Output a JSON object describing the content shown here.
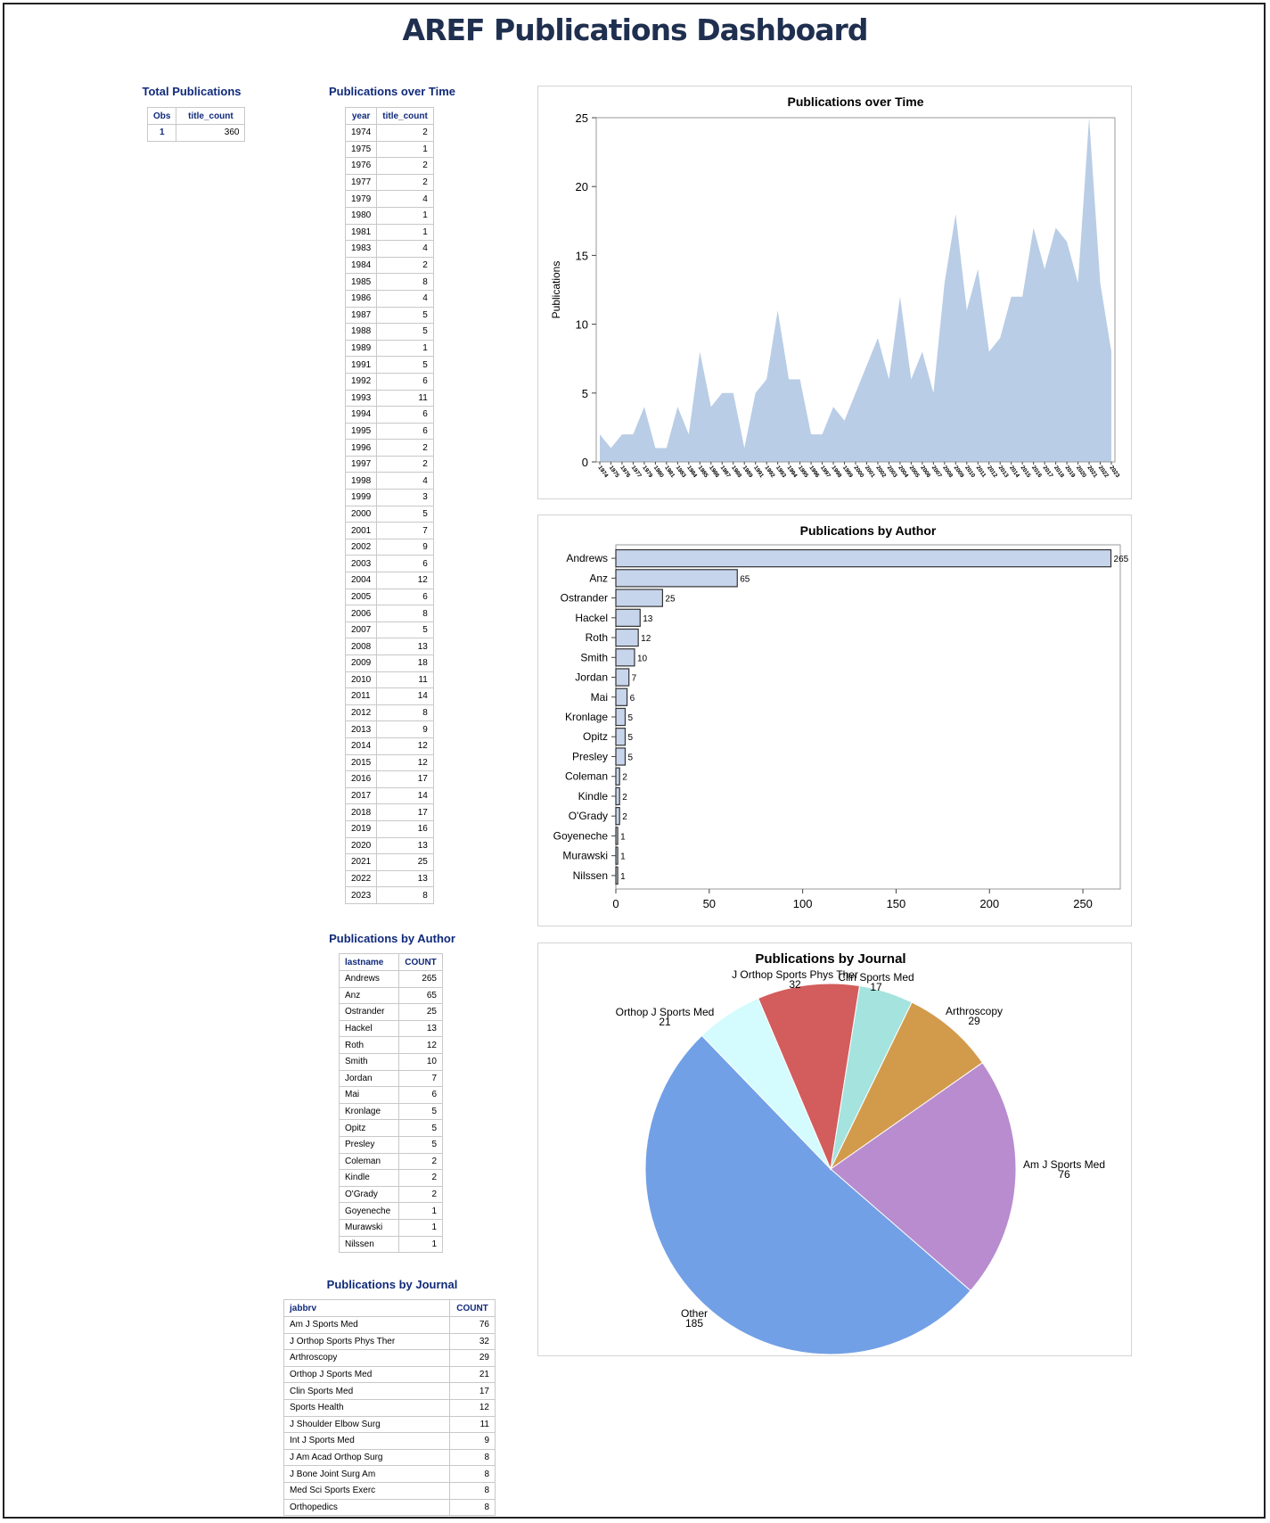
{
  "page": {
    "title": "AREF Publications Dashboard"
  },
  "total": {
    "title": "Total Publications",
    "headers": [
      "Obs",
      "title_count"
    ],
    "rows": [
      [
        "1",
        "360"
      ]
    ]
  },
  "time_table": {
    "title": "Publications over Time",
    "headers": [
      "year",
      "title_count"
    ]
  },
  "author_table": {
    "title": "Publications by Author",
    "headers": [
      "lastname",
      "COUNT"
    ]
  },
  "journal_table": {
    "title": "Publications by Journal",
    "headers": [
      "jabbrv",
      "COUNT"
    ],
    "rows": [
      [
        "Am J Sports Med",
        "76"
      ],
      [
        "J Orthop Sports Phys Ther",
        "32"
      ],
      [
        "Arthroscopy",
        "29"
      ],
      [
        "Orthop J Sports Med",
        "21"
      ],
      [
        "Clin Sports Med",
        "17"
      ],
      [
        "Sports Health",
        "12"
      ],
      [
        "J Shoulder Elbow Surg",
        "11"
      ],
      [
        "Int J Sports Med",
        "9"
      ],
      [
        "J Am Acad Orthop Surg",
        "8"
      ],
      [
        "J Bone Joint Surg Am",
        "8"
      ],
      [
        "Med Sci Sports Exerc",
        "8"
      ],
      [
        "Orthopedics",
        "8"
      ]
    ]
  },
  "chart_data": [
    {
      "type": "area",
      "title": "Publications over Time",
      "xlabel": "",
      "ylabel": "Publications",
      "ylim": [
        0,
        25
      ],
      "yticks": [
        0,
        5,
        10,
        15,
        20,
        25
      ],
      "color": "#b9cde6",
      "x": [
        "1974",
        "1975",
        "1976",
        "1977",
        "1979",
        "1980",
        "1981",
        "1983",
        "1984",
        "1985",
        "1986",
        "1987",
        "1988",
        "1989",
        "1991",
        "1992",
        "1993",
        "1994",
        "1995",
        "1996",
        "1997",
        "1998",
        "1999",
        "2000",
        "2001",
        "2002",
        "2003",
        "2004",
        "2005",
        "2006",
        "2007",
        "2008",
        "2009",
        "2010",
        "2011",
        "2012",
        "2013",
        "2014",
        "2015",
        "2016",
        "2017",
        "2018",
        "2019",
        "2020",
        "2021",
        "2022",
        "2023"
      ],
      "values": [
        2,
        1,
        2,
        2,
        4,
        1,
        1,
        4,
        2,
        8,
        4,
        5,
        5,
        1,
        5,
        6,
        11,
        6,
        6,
        2,
        2,
        4,
        3,
        5,
        7,
        9,
        6,
        12,
        6,
        8,
        5,
        13,
        18,
        11,
        14,
        8,
        9,
        12,
        12,
        17,
        14,
        17,
        16,
        13,
        25,
        13,
        8
      ]
    },
    {
      "type": "bar",
      "orientation": "horizontal",
      "title": "Publications by Author",
      "xlim": [
        0,
        270
      ],
      "xticks": [
        0,
        50,
        100,
        150,
        200,
        250
      ],
      "color": "#c7d5ec",
      "categories": [
        "Andrews",
        "Anz",
        "Ostrander",
        "Hackel",
        "Roth",
        "Smith",
        "Jordan",
        "Mai",
        "Kronlage",
        "Opitz",
        "Presley",
        "Coleman",
        "Kindle",
        "O'Grady",
        "Goyeneche",
        "Murawski",
        "Nilssen"
      ],
      "values": [
        265,
        65,
        25,
        13,
        12,
        10,
        7,
        6,
        5,
        5,
        5,
        2,
        2,
        2,
        1,
        1,
        1
      ]
    },
    {
      "type": "pie",
      "title": "Publications by Journal",
      "categories": [
        "Am J Sports Med",
        "Other",
        "Orthop J Sports Med",
        "J Orthop Sports Phys Ther",
        "Clin Sports Med",
        "Arthroscopy"
      ],
      "values": [
        76,
        185,
        21,
        32,
        17,
        29
      ],
      "colors": [
        "#b88ccf",
        "#72a0e6",
        "#d4fbfd",
        "#d35c5c",
        "#a4e3de",
        "#d29b4c"
      ]
    }
  ]
}
